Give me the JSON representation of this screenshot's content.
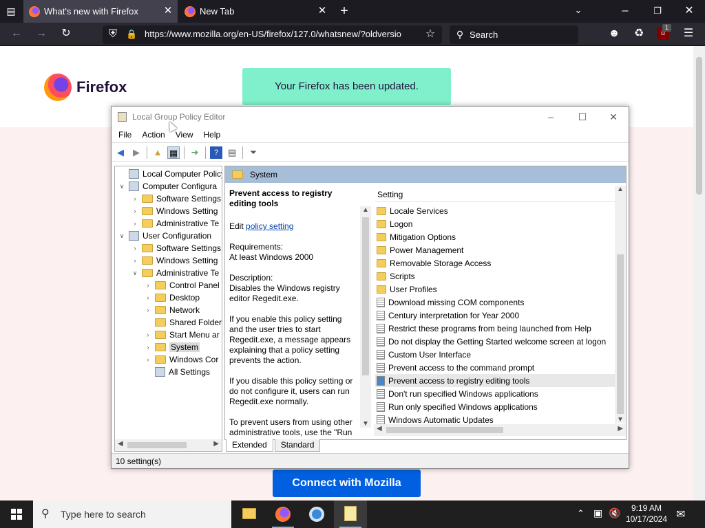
{
  "browser": {
    "tabs": [
      {
        "title": "What's new with Firefox",
        "active": true
      },
      {
        "title": "New Tab",
        "active": false
      }
    ],
    "url": "https://www.mozilla.org/en-US/firefox/127.0/whatsnew/?oldversio",
    "search_placeholder": "Search",
    "extension_badge": "1"
  },
  "page": {
    "logo_text": "Firefox",
    "banner": "Your Firefox has been updated.",
    "cta": "Connect with Mozilla"
  },
  "gpedit": {
    "title": "Local Group Policy Editor",
    "menu": [
      "File",
      "Action",
      "View",
      "Help"
    ],
    "tree": [
      {
        "label": "Local Computer Policy",
        "level": 0,
        "toggle": "",
        "icon": "policy"
      },
      {
        "label": "Computer Configura",
        "level": 0,
        "toggle": "v",
        "icon": "computer"
      },
      {
        "label": "Software Settings",
        "level": 1,
        "toggle": ">",
        "icon": "folder"
      },
      {
        "label": "Windows Setting",
        "level": 1,
        "toggle": ">",
        "icon": "folder"
      },
      {
        "label": "Administrative Te",
        "level": 1,
        "toggle": ">",
        "icon": "folder"
      },
      {
        "label": "User Configuration",
        "level": 0,
        "toggle": "v",
        "icon": "computer"
      },
      {
        "label": "Software Settings",
        "level": 1,
        "toggle": ">",
        "icon": "folder"
      },
      {
        "label": "Windows Setting",
        "level": 1,
        "toggle": ">",
        "icon": "folder"
      },
      {
        "label": "Administrative Te",
        "level": 1,
        "toggle": "v",
        "icon": "folder"
      },
      {
        "label": "Control Panel",
        "level": 2,
        "toggle": ">",
        "icon": "folder"
      },
      {
        "label": "Desktop",
        "level": 2,
        "toggle": ">",
        "icon": "folder"
      },
      {
        "label": "Network",
        "level": 2,
        "toggle": ">",
        "icon": "folder"
      },
      {
        "label": "Shared Folder",
        "level": 2,
        "toggle": "",
        "icon": "folder"
      },
      {
        "label": "Start Menu ar",
        "level": 2,
        "toggle": ">",
        "icon": "folder"
      },
      {
        "label": "System",
        "level": 2,
        "toggle": ">",
        "icon": "folder",
        "selected": true
      },
      {
        "label": "Windows Cor",
        "level": 2,
        "toggle": ">",
        "icon": "folder"
      },
      {
        "label": "All Settings",
        "level": 2,
        "toggle": "",
        "icon": "settings"
      }
    ],
    "pane_header": "System",
    "description": {
      "title": "Prevent access to registry editing tools",
      "edit_prefix": "Edit",
      "edit_link": "policy setting",
      "requirements_label": "Requirements:",
      "requirements": "At least Windows 2000",
      "description_label": "Description:",
      "description": "Disables the Windows registry editor Regedit.exe.",
      "para1": "If you enable this policy setting and the user tries to start Regedit.exe, a message appears explaining that a policy setting prevents the action.",
      "para2": "If you disable this policy setting or do not configure it, users can run Regedit.exe normally.",
      "para3": "To prevent users from using other administrative tools, use the \"Run"
    },
    "list_header": "Setting",
    "settings": [
      {
        "label": "Locale Services",
        "type": "folder"
      },
      {
        "label": "Logon",
        "type": "folder"
      },
      {
        "label": "Mitigation Options",
        "type": "folder"
      },
      {
        "label": "Power Management",
        "type": "folder"
      },
      {
        "label": "Removable Storage Access",
        "type": "folder"
      },
      {
        "label": "Scripts",
        "type": "folder"
      },
      {
        "label": "User Profiles",
        "type": "folder"
      },
      {
        "label": "Download missing COM components",
        "type": "policy"
      },
      {
        "label": "Century interpretation for Year 2000",
        "type": "policy"
      },
      {
        "label": "Restrict these programs from being launched from Help",
        "type": "policy"
      },
      {
        "label": "Do not display the Getting Started welcome screen at logon",
        "type": "policy"
      },
      {
        "label": "Custom User Interface",
        "type": "policy"
      },
      {
        "label": "Prevent access to the command prompt",
        "type": "policy"
      },
      {
        "label": "Prevent access to registry editing tools",
        "type": "policy",
        "selected": true
      },
      {
        "label": "Don't run specified Windows applications",
        "type": "policy"
      },
      {
        "label": "Run only specified Windows applications",
        "type": "policy"
      },
      {
        "label": "Windows Automatic Updates",
        "type": "policy"
      }
    ],
    "view_tabs": [
      "Extended",
      "Standard"
    ],
    "status": "10 setting(s)"
  },
  "taskbar": {
    "search_placeholder": "Type here to search",
    "time": "9:19 AM",
    "date": "10/17/2024"
  }
}
